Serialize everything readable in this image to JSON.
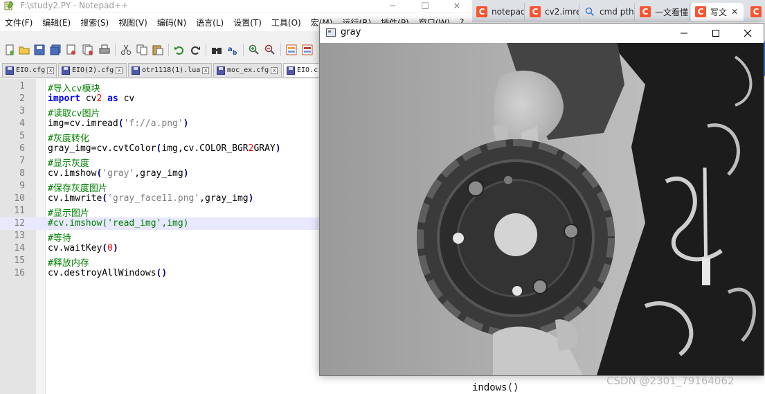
{
  "notepad": {
    "title": "F:\\study2.PY - Notepad++",
    "menu": [
      "文件(F)",
      "编辑(E)",
      "搜索(S)",
      "视图(V)",
      "编码(N)",
      "语言(L)",
      "设置(T)",
      "工具(O)",
      "宏(M)",
      "运行(R)",
      "插件(P)",
      "窗口(W)",
      "?"
    ],
    "tabs": [
      "EIO.cfg",
      "EIO(2).cfg",
      "otr1118(1).lua",
      "moc_ex.cfg",
      "EIO.c"
    ],
    "code_lines": [
      "#导入cv模块",
      "import cv2 as cv",
      "#读取cv图片",
      "img=cv.imread('f://a.png')",
      "#灰度转化",
      "gray_img=cv.cvtColor(img,cv.COLOR_BGR2GRAY)",
      "#显示灰度",
      "cv.imshow('gray',gray_img)",
      "#保存灰度图片",
      "cv.imwrite('gray_face11.png',gray_img)",
      "#显示图片",
      "#cv.imshow('read_img',img)",
      "#等待",
      "cv.waitKey(0)",
      "#释放内存",
      "cv.destroyAllWindows()"
    ],
    "current_line": 12
  },
  "browser": {
    "tabs": [
      {
        "label": "notepad",
        "icon": "csdn-icon"
      },
      {
        "label": "cv2.imre",
        "icon": "csdn-icon"
      },
      {
        "label": "cmd pth",
        "icon": "search-icon"
      },
      {
        "label": "一文看懂",
        "icon": "csdn-icon"
      },
      {
        "label": "写文",
        "icon": "csdn-icon",
        "active": true
      }
    ],
    "code_fragment": "indows()",
    "watermark": "CSDN @2301_79164062"
  },
  "gray_window": {
    "title": "gray"
  },
  "colors": {
    "comment": "#008000",
    "keyword": "#0000ff",
    "string": "#808080",
    "number": "#ff0000",
    "csdn": "#fc5531",
    "current_line_bg": "#e8e8ff"
  }
}
